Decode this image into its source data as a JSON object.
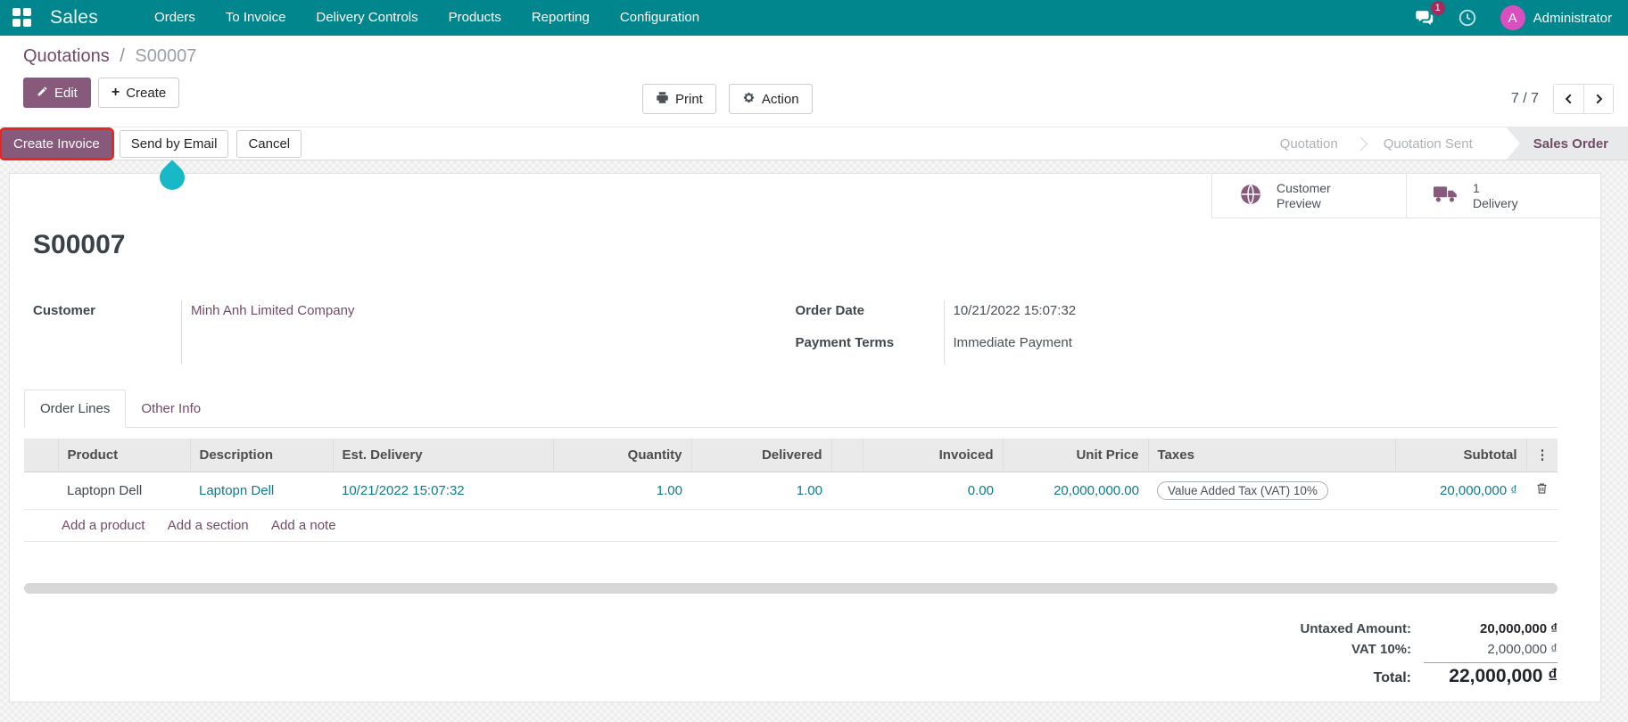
{
  "colors": {
    "navbar_teal": "#00868C",
    "primary_purple": "#875A7B",
    "breadcrumb_purple": "#714B67",
    "cell_link_teal": "#0e7b8d",
    "highlight_red": "#e7271d",
    "click_indicator_cyan": "#19b8c7",
    "badge_maroon": "#a22c5d",
    "avatar_magenta": "#d94fc0"
  },
  "icons": {
    "apps": "grid-2x2",
    "messages": "speech-bubbles",
    "activities": "clock",
    "edit": "pencil",
    "create": "plus",
    "print": "printer",
    "action": "gear",
    "customer_preview": "globe",
    "delivery": "truck",
    "delete_line": "trash",
    "optional_columns": "vertical-ellipsis"
  },
  "navbar": {
    "brand": "Sales",
    "items": [
      "Orders",
      "To Invoice",
      "Delivery Controls",
      "Products",
      "Reporting",
      "Configuration"
    ],
    "systray": {
      "message_badge": "1",
      "avatar_initial": "A",
      "user": "Administrator"
    }
  },
  "breadcrumb": {
    "parent": "Quotations",
    "separator": "/",
    "current": "S00007"
  },
  "actions": {
    "edit": "Edit",
    "create": "Create",
    "print": "Print",
    "action": "Action"
  },
  "pager": {
    "value": "7 / 7"
  },
  "statusbar": {
    "create_invoice": "Create Invoice",
    "send_by_email": "Send by Email",
    "cancel": "Cancel",
    "state_quotation": "Quotation",
    "state_quotation_sent": "Quotation Sent",
    "state_sales_order": "Sales Order",
    "active_state": "Sales Order"
  },
  "smart_buttons": {
    "customer_preview_label": "Customer Preview",
    "delivery_count": "1",
    "delivery_label": "Delivery"
  },
  "record": {
    "name": "S00007",
    "customer_label": "Customer",
    "customer_value": "Minh Anh Limited Company",
    "order_date_label": "Order Date",
    "order_date_value": "10/21/2022 15:07:32",
    "payment_terms_label": "Payment Terms",
    "payment_terms_value": "Immediate Payment"
  },
  "tabs": {
    "order_lines": "Order Lines",
    "other_info": "Other Info"
  },
  "order_lines": {
    "columns": [
      "Product",
      "Description",
      "Est. Delivery",
      "Quantity",
      "Delivered",
      "Invoiced",
      "Unit Price",
      "Taxes",
      "Subtotal"
    ],
    "row": {
      "product": "Laptopn Dell",
      "description": "Laptopn Dell",
      "est_delivery": "10/21/2022 15:07:32",
      "quantity": "1.00",
      "delivered": "1.00",
      "invoiced": "0.00",
      "unit_price": "20,000,000.00",
      "taxes": "Value Added Tax (VAT) 10%",
      "subtotal": "20,000,000 ₫"
    },
    "add_product": "Add a product",
    "add_section": "Add a section",
    "add_note": "Add a note"
  },
  "totals": {
    "untaxed_label": "Untaxed Amount:",
    "untaxed_value": "20,000,000 ₫",
    "vat_label": "VAT 10%:",
    "vat_value": "2,000,000 ₫",
    "total_label": "Total:",
    "total_value": "22,000,000 ₫"
  }
}
